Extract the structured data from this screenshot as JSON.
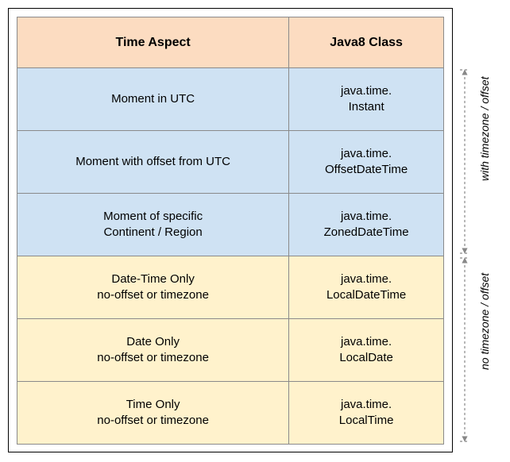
{
  "table": {
    "headers": [
      "Time Aspect",
      "Java8 Class"
    ],
    "rows": [
      {
        "aspect_l1": "Moment in UTC",
        "aspect_l2": "",
        "class_l1": "java.time.",
        "class_l2": "Instant",
        "group": "with"
      },
      {
        "aspect_l1": "Moment with offset from UTC",
        "aspect_l2": "",
        "class_l1": "java.time.",
        "class_l2": "OffsetDateTime",
        "group": "with"
      },
      {
        "aspect_l1": "Moment of specific",
        "aspect_l2": "Continent / Region",
        "class_l1": "java.time.",
        "class_l2": "ZonedDateTime",
        "group": "with"
      },
      {
        "aspect_l1": "Date-Time Only",
        "aspect_l2": "no-offset or timezone",
        "class_l1": "java.time.",
        "class_l2": "LocalDateTime",
        "group": "no"
      },
      {
        "aspect_l1": "Date Only",
        "aspect_l2": "no-offset or timezone",
        "class_l1": "java.time.",
        "class_l2": "LocalDate",
        "group": "no"
      },
      {
        "aspect_l1": "Time Only",
        "aspect_l2": "no-offset or timezone",
        "class_l1": "java.time.",
        "class_l2": "LocalTime",
        "group": "no"
      }
    ]
  },
  "annotations": {
    "with_label": "with timezone  / offset",
    "no_label": "no timezone / offset"
  },
  "chart_data": {
    "type": "table",
    "title": "Java 8 java.time classes by time aspect",
    "columns": [
      "Time Aspect",
      "Java8 Class"
    ],
    "groups": [
      {
        "label": "with timezone / offset",
        "rows": [
          [
            "Moment in UTC",
            "java.time.Instant"
          ],
          [
            "Moment with offset from UTC",
            "java.time.OffsetDateTime"
          ],
          [
            "Moment of specific Continent / Region",
            "java.time.ZonedDateTime"
          ]
        ]
      },
      {
        "label": "no timezone / offset",
        "rows": [
          [
            "Date-Time Only no-offset or timezone",
            "java.time.LocalDateTime"
          ],
          [
            "Date Only no-offset or timezone",
            "java.time.LocalDate"
          ],
          [
            "Time Only no-offset or timezone",
            "java.time.LocalTime"
          ]
        ]
      }
    ]
  }
}
